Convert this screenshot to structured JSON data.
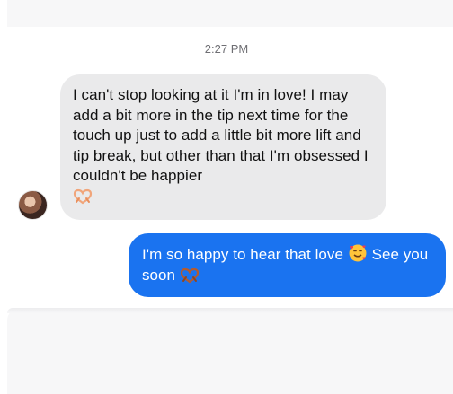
{
  "conversation": {
    "timestamp": "2:27 PM",
    "messages": [
      {
        "direction": "incoming",
        "text": "I can't stop looking at it I'm in love! I may add a bit more in the tip next time for the touch up just to add a little bit more lift and tip break, but other than that I'm obsessed I couldn't be happier",
        "emoji": "heart-hands"
      },
      {
        "direction": "outgoing",
        "text_before_emoji": "I'm so happy to hear that love",
        "emoji": "smiling-face-with-hearts",
        "text_after_emoji": "See you soon",
        "trailing_emoji": "heart-hands"
      }
    ]
  },
  "colors": {
    "incoming_bubble": "#eaeaeb",
    "outgoing_bubble": "#1a73f0",
    "timestamp_text": "#6e6e73"
  }
}
